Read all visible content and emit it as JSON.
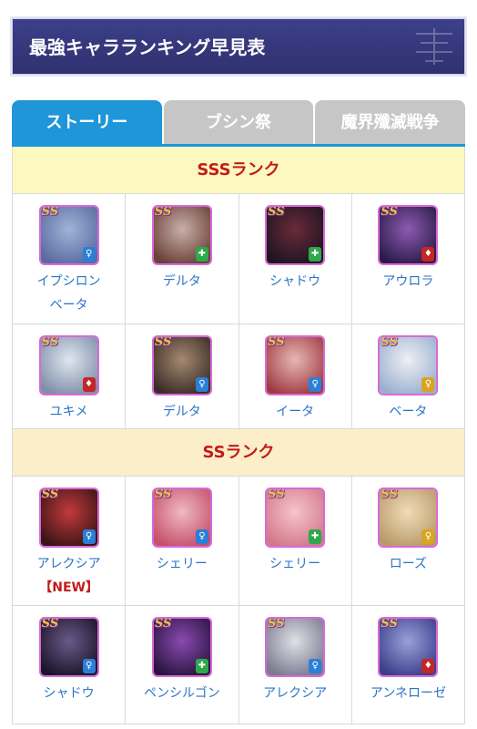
{
  "page": {
    "title": "最強キャラランキング早見表"
  },
  "tabs": [
    {
      "label": "ストーリー",
      "active": true
    },
    {
      "label": "ブシン祭",
      "active": false
    },
    {
      "label": "魔界殲滅戦争",
      "active": false
    }
  ],
  "badge_text": "SS",
  "colors": {
    "tab_active": "#1e96d8",
    "rank_text": "#c11c1c",
    "name_text": "#2a74c6",
    "role_blue": "#2b7fd6",
    "role_green": "#2ea84a",
    "role_red": "#c22626",
    "role_yellow": "#d9a520"
  },
  "ranks": [
    {
      "label": "SSSランク",
      "rows": [
        [
          {
            "name": "イプシロン",
            "name2": "ベータ",
            "role": "blue",
            "art": [
              "#9fb4d8",
              "#5a6aa0"
            ]
          },
          {
            "name": "デルタ",
            "role": "green",
            "art": [
              "#c8b0a8",
              "#6b3f3a"
            ]
          },
          {
            "name": "シャドウ",
            "role": "green",
            "art": [
              "#6a2a3a",
              "#1c1420"
            ]
          },
          {
            "name": "アウロラ",
            "role": "red",
            "art": [
              "#8d5bb0",
              "#2a1a4a"
            ]
          }
        ],
        [
          {
            "name": "ユキメ",
            "role": "red",
            "art": [
              "#dfe6f0",
              "#7f8fa8"
            ]
          },
          {
            "name": "デルタ",
            "role": "blue",
            "art": [
              "#a48a70",
              "#3b2c26"
            ]
          },
          {
            "name": "イータ",
            "role": "blue",
            "art": [
              "#e6b8b4",
              "#a03a42"
            ]
          },
          {
            "name": "ベータ",
            "role": "yellow",
            "art": [
              "#eef0f4",
              "#9ab0d0"
            ]
          }
        ]
      ]
    },
    {
      "label": "SSランク",
      "rows": [
        [
          {
            "name": "アレクシア",
            "new": "【NEW】",
            "role": "blue",
            "art": [
              "#c23a3a",
              "#3a1416"
            ]
          },
          {
            "name": "シェリー",
            "role": "blue",
            "art": [
              "#f1b8c4",
              "#c4506a"
            ]
          },
          {
            "name": "シェリー",
            "role": "green",
            "art": [
              "#f6c4cc",
              "#d2788a"
            ]
          },
          {
            "name": "ローズ",
            "role": "yellow",
            "art": [
              "#f0dcb8",
              "#b89a6a"
            ]
          }
        ],
        [
          {
            "name": "シャドウ",
            "role": "blue",
            "art": [
              "#6a5a8a",
              "#1a1428"
            ]
          },
          {
            "name": "ペンシルゴン",
            "role": "green",
            "art": [
              "#8a4ab0",
              "#2a1440"
            ]
          },
          {
            "name": "アレクシア",
            "role": "blue",
            "art": [
              "#e0e0e6",
              "#7a7a90"
            ]
          },
          {
            "name": "アンネローゼ",
            "role": "red",
            "art": [
              "#9aa0d8",
              "#3a3e8a"
            ]
          }
        ]
      ]
    }
  ]
}
